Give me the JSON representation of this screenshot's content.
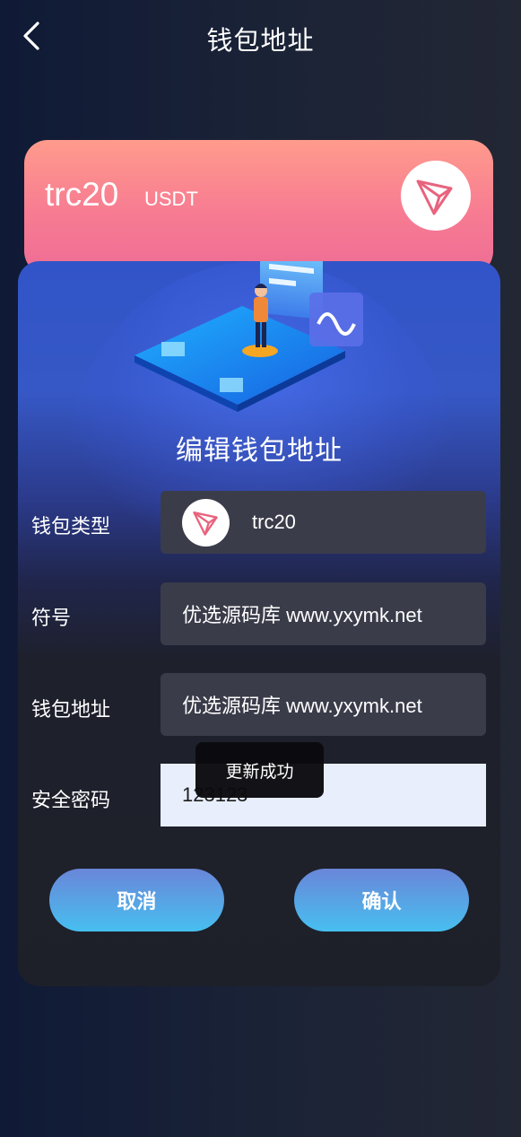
{
  "header": {
    "title": "钱包地址",
    "back_icon": "chevron-left-icon"
  },
  "card": {
    "name": "trc20",
    "symbol": "USDT",
    "logo_icon": "tron-logo-icon"
  },
  "dialog": {
    "title": "编辑钱包地址",
    "fields": {
      "wallet_type": {
        "label": "钱包类型",
        "value": "trc20",
        "icon": "tron-logo-icon"
      },
      "symbol": {
        "label": "符号",
        "value": "优选源码库 www.yxymk.net"
      },
      "address": {
        "label": "钱包地址",
        "value": "优选源码库 www.yxymk.net"
      },
      "password": {
        "label": "安全密码",
        "value": "123123"
      }
    },
    "toast": "更新成功",
    "buttons": {
      "cancel": "取消",
      "confirm": "确认"
    }
  },
  "colors": {
    "card_top": "#ff9b8c",
    "card_bottom": "#ee6d95",
    "panel_top": "#3154c8",
    "button_top": "#6a86d8",
    "button_bottom": "#47bff0",
    "tron": "#e8637d"
  }
}
